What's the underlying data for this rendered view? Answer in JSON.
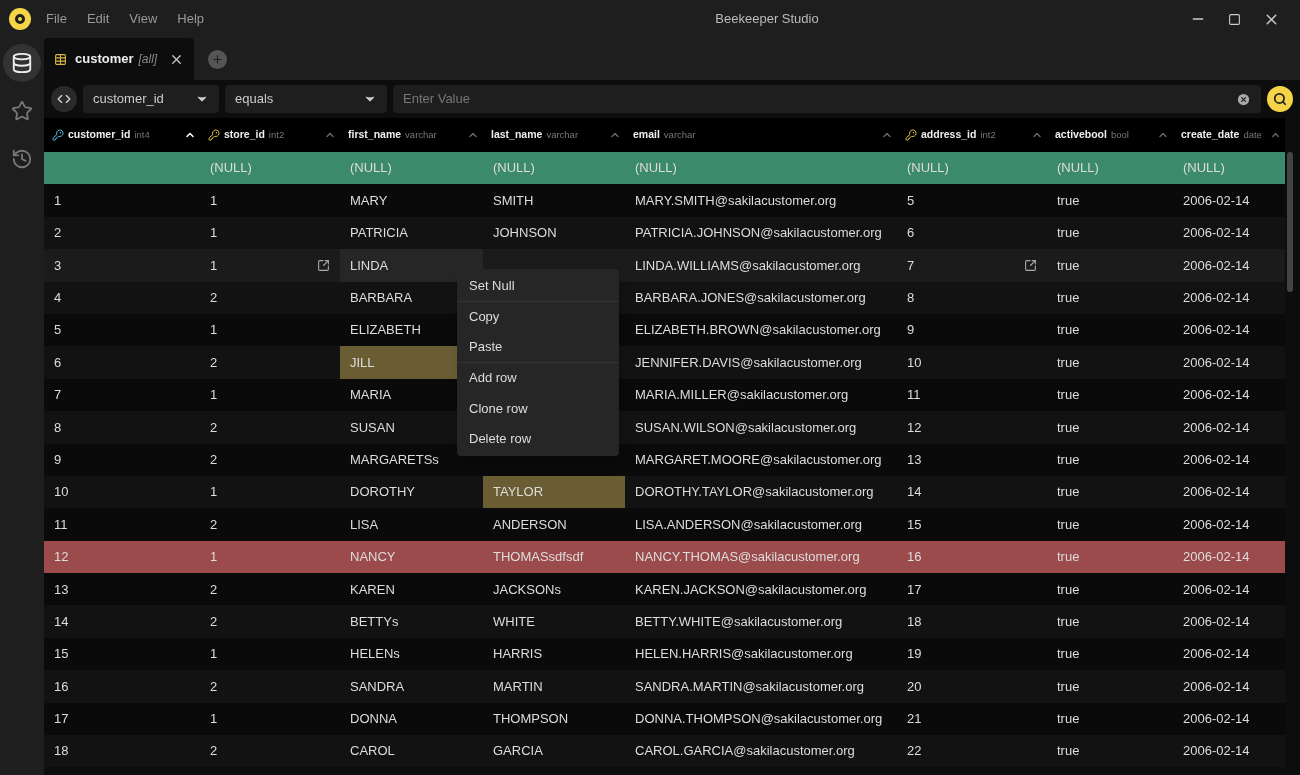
{
  "window": {
    "title": "Beekeeper Studio"
  },
  "menu_bar": [
    "File",
    "Edit",
    "View",
    "Help"
  ],
  "sidebar": [
    {
      "selected": true
    },
    {
      "selected": false
    },
    {
      "selected": false
    }
  ],
  "tabs": [
    {
      "label": "customer",
      "suffix": "[all]",
      "selected": true
    }
  ],
  "filter": {
    "column": "customer_id",
    "operator": "equals",
    "placeholder": "Enter Value"
  },
  "table": {
    "columns": [
      {
        "name": "customer_id",
        "type": "int4",
        "kind": "primary",
        "sorted": true
      },
      {
        "name": "store_id",
        "type": "int2",
        "kind": "foreign",
        "sorted": false
      },
      {
        "name": "first_name",
        "type": "varchar",
        "kind": "plain",
        "sorted": false
      },
      {
        "name": "last_name",
        "type": "varchar",
        "kind": "plain",
        "sorted": false
      },
      {
        "name": "email",
        "type": "varchar",
        "kind": "plain",
        "sorted": false
      },
      {
        "name": "address_id",
        "type": "int2",
        "kind": "foreign",
        "sorted": false
      },
      {
        "name": "activebool",
        "type": "bool",
        "kind": "plain",
        "sorted": false
      },
      {
        "name": "create_date",
        "type": "date",
        "kind": "plain",
        "sorted": false
      }
    ],
    "rows": [
      {
        "kind": "new",
        "hovered": false,
        "cells": [
          {
            "text": null,
            "edited": false
          },
          {
            "text": "(NULL)",
            "edited": false
          },
          {
            "text": "(NULL)",
            "edited": false
          },
          {
            "text": "(NULL)",
            "edited": false
          },
          {
            "text": "(NULL)",
            "edited": false
          },
          {
            "text": "(NULL)",
            "edited": false
          },
          {
            "text": "(NULL)",
            "edited": false
          },
          {
            "text": "(NULL)",
            "edited": false
          }
        ]
      },
      {
        "kind": "normal",
        "hovered": false,
        "cells": [
          {
            "text": "1",
            "edited": false
          },
          {
            "text": "1",
            "edited": false
          },
          {
            "text": "MARY",
            "edited": false
          },
          {
            "text": "SMITH",
            "edited": false
          },
          {
            "text": "MARY.SMITH@sakilacustomer.org",
            "edited": false
          },
          {
            "text": "5",
            "edited": false
          },
          {
            "text": "true",
            "edited": false
          },
          {
            "text": "2006-02-14",
            "edited": false
          }
        ]
      },
      {
        "kind": "normal",
        "hovered": false,
        "cells": [
          {
            "text": "2",
            "edited": false
          },
          {
            "text": "1",
            "edited": false
          },
          {
            "text": "PATRICIA",
            "edited": false
          },
          {
            "text": "JOHNSON",
            "edited": false
          },
          {
            "text": "PATRICIA.JOHNSON@sakilacustomer.org",
            "edited": false
          },
          {
            "text": "6",
            "edited": false
          },
          {
            "text": "true",
            "edited": false
          },
          {
            "text": "2006-02-14",
            "edited": false
          }
        ]
      },
      {
        "kind": "normal",
        "hovered": true,
        "cells": [
          {
            "text": "3",
            "edited": false
          },
          {
            "text": "1",
            "edited": false
          },
          {
            "text": "LINDA",
            "edited": false
          },
          {
            "text": null,
            "edited": false
          },
          {
            "text": "LINDA.WILLIAMS@sakilacustomer.org",
            "edited": false
          },
          {
            "text": "7",
            "edited": false
          },
          {
            "text": "true",
            "edited": false
          },
          {
            "text": "2006-02-14",
            "edited": false
          }
        ]
      },
      {
        "kind": "normal",
        "hovered": false,
        "cells": [
          {
            "text": "4",
            "edited": false
          },
          {
            "text": "2",
            "edited": false
          },
          {
            "text": "BARBARA",
            "edited": false
          },
          {
            "text": null,
            "edited": false
          },
          {
            "text": "BARBARA.JONES@sakilacustomer.org",
            "edited": false
          },
          {
            "text": "8",
            "edited": false
          },
          {
            "text": "true",
            "edited": false
          },
          {
            "text": "2006-02-14",
            "edited": false
          }
        ]
      },
      {
        "kind": "normal",
        "hovered": false,
        "cells": [
          {
            "text": "5",
            "edited": false
          },
          {
            "text": "1",
            "edited": false
          },
          {
            "text": "ELIZABETH",
            "edited": false
          },
          {
            "text": null,
            "edited": false
          },
          {
            "text": "ELIZABETH.BROWN@sakilacustomer.org",
            "edited": false
          },
          {
            "text": "9",
            "edited": false
          },
          {
            "text": "true",
            "edited": false
          },
          {
            "text": "2006-02-14",
            "edited": false
          }
        ]
      },
      {
        "kind": "normal",
        "hovered": false,
        "cells": [
          {
            "text": "6",
            "edited": false
          },
          {
            "text": "2",
            "edited": false
          },
          {
            "text": "JILL",
            "edited": true
          },
          {
            "text": null,
            "edited": false
          },
          {
            "text": "JENNIFER.DAVIS@sakilacustomer.org",
            "edited": false
          },
          {
            "text": "10",
            "edited": false
          },
          {
            "text": "true",
            "edited": false
          },
          {
            "text": "2006-02-14",
            "edited": false
          }
        ]
      },
      {
        "kind": "normal",
        "hovered": false,
        "cells": [
          {
            "text": "7",
            "edited": false
          },
          {
            "text": "1",
            "edited": false
          },
          {
            "text": "MARIA",
            "edited": false
          },
          {
            "text": null,
            "edited": false
          },
          {
            "text": "MARIA.MILLER@sakilacustomer.org",
            "edited": false
          },
          {
            "text": "11",
            "edited": false
          },
          {
            "text": "true",
            "edited": false
          },
          {
            "text": "2006-02-14",
            "edited": false
          }
        ]
      },
      {
        "kind": "normal",
        "hovered": false,
        "cells": [
          {
            "text": "8",
            "edited": false
          },
          {
            "text": "2",
            "edited": false
          },
          {
            "text": "SUSAN",
            "edited": false
          },
          {
            "text": null,
            "edited": false
          },
          {
            "text": "SUSAN.WILSON@sakilacustomer.org",
            "edited": false
          },
          {
            "text": "12",
            "edited": false
          },
          {
            "text": "true",
            "edited": false
          },
          {
            "text": "2006-02-14",
            "edited": false
          }
        ]
      },
      {
        "kind": "normal",
        "hovered": false,
        "cells": [
          {
            "text": "9",
            "edited": false
          },
          {
            "text": "2",
            "edited": false
          },
          {
            "text": "MARGARETSs",
            "edited": false
          },
          {
            "text": null,
            "edited": false
          },
          {
            "text": "MARGARET.MOORE@sakilacustomer.org",
            "edited": false
          },
          {
            "text": "13",
            "edited": false
          },
          {
            "text": "true",
            "edited": false
          },
          {
            "text": "2006-02-14",
            "edited": false
          }
        ]
      },
      {
        "kind": "normal",
        "hovered": false,
        "cells": [
          {
            "text": "10",
            "edited": false
          },
          {
            "text": "1",
            "edited": false
          },
          {
            "text": "DOROTHY",
            "edited": false
          },
          {
            "text": "TAYLOR",
            "edited": true
          },
          {
            "text": "DOROTHY.TAYLOR@sakilacustomer.org",
            "edited": false
          },
          {
            "text": "14",
            "edited": false
          },
          {
            "text": "true",
            "edited": false
          },
          {
            "text": "2006-02-14",
            "edited": false
          }
        ]
      },
      {
        "kind": "normal",
        "hovered": false,
        "cells": [
          {
            "text": "11",
            "edited": false
          },
          {
            "text": "2",
            "edited": false
          },
          {
            "text": "LISA",
            "edited": false
          },
          {
            "text": "ANDERSON",
            "edited": false
          },
          {
            "text": "LISA.ANDERSON@sakilacustomer.org",
            "edited": false
          },
          {
            "text": "15",
            "edited": false
          },
          {
            "text": "true",
            "edited": false
          },
          {
            "text": "2006-02-14",
            "edited": false
          }
        ]
      },
      {
        "kind": "deleted",
        "hovered": false,
        "cells": [
          {
            "text": "12",
            "edited": false
          },
          {
            "text": "1",
            "edited": false
          },
          {
            "text": "NANCY",
            "edited": false
          },
          {
            "text": "THOMASsdfsdf",
            "edited": false
          },
          {
            "text": "NANCY.THOMAS@sakilacustomer.org",
            "edited": false
          },
          {
            "text": "16",
            "edited": false
          },
          {
            "text": "true",
            "edited": false
          },
          {
            "text": "2006-02-14",
            "edited": false
          }
        ]
      },
      {
        "kind": "normal",
        "hovered": false,
        "cells": [
          {
            "text": "13",
            "edited": false
          },
          {
            "text": "2",
            "edited": false
          },
          {
            "text": "KAREN",
            "edited": false
          },
          {
            "text": "JACKSONs",
            "edited": false
          },
          {
            "text": "KAREN.JACKSON@sakilacustomer.org",
            "edited": false
          },
          {
            "text": "17",
            "edited": false
          },
          {
            "text": "true",
            "edited": false
          },
          {
            "text": "2006-02-14",
            "edited": false
          }
        ]
      },
      {
        "kind": "normal",
        "hovered": false,
        "cells": [
          {
            "text": "14",
            "edited": false
          },
          {
            "text": "2",
            "edited": false
          },
          {
            "text": "BETTYs",
            "edited": false
          },
          {
            "text": "WHITE",
            "edited": false
          },
          {
            "text": "BETTY.WHITE@sakilacustomer.org",
            "edited": false
          },
          {
            "text": "18",
            "edited": false
          },
          {
            "text": "true",
            "edited": false
          },
          {
            "text": "2006-02-14",
            "edited": false
          }
        ]
      },
      {
        "kind": "normal",
        "hovered": false,
        "cells": [
          {
            "text": "15",
            "edited": false
          },
          {
            "text": "1",
            "edited": false
          },
          {
            "text": "HELENs",
            "edited": false
          },
          {
            "text": "HARRIS",
            "edited": false
          },
          {
            "text": "HELEN.HARRIS@sakilacustomer.org",
            "edited": false
          },
          {
            "text": "19",
            "edited": false
          },
          {
            "text": "true",
            "edited": false
          },
          {
            "text": "2006-02-14",
            "edited": false
          }
        ]
      },
      {
        "kind": "normal",
        "hovered": false,
        "cells": [
          {
            "text": "16",
            "edited": false
          },
          {
            "text": "2",
            "edited": false
          },
          {
            "text": "SANDRA",
            "edited": false
          },
          {
            "text": "MARTIN",
            "edited": false
          },
          {
            "text": "SANDRA.MARTIN@sakilacustomer.org",
            "edited": false
          },
          {
            "text": "20",
            "edited": false
          },
          {
            "text": "true",
            "edited": false
          },
          {
            "text": "2006-02-14",
            "edited": false
          }
        ]
      },
      {
        "kind": "normal",
        "hovered": false,
        "cells": [
          {
            "text": "17",
            "edited": false
          },
          {
            "text": "1",
            "edited": false
          },
          {
            "text": "DONNA",
            "edited": false
          },
          {
            "text": "THOMPSON",
            "edited": false
          },
          {
            "text": "DONNA.THOMPSON@sakilacustomer.org",
            "edited": false
          },
          {
            "text": "21",
            "edited": false
          },
          {
            "text": "true",
            "edited": false
          },
          {
            "text": "2006-02-14",
            "edited": false
          }
        ]
      },
      {
        "kind": "normal",
        "hovered": false,
        "cells": [
          {
            "text": "18",
            "edited": false
          },
          {
            "text": "2",
            "edited": false
          },
          {
            "text": "CAROL",
            "edited": false
          },
          {
            "text": "GARCIA",
            "edited": false
          },
          {
            "text": "CAROL.GARCIA@sakilacustomer.org",
            "edited": false
          },
          {
            "text": "22",
            "edited": false
          },
          {
            "text": "true",
            "edited": false
          },
          {
            "text": "2006-02-14",
            "edited": false
          }
        ]
      }
    ]
  },
  "context_menu": [
    {
      "label": "Set Null",
      "divider_after": true
    },
    {
      "label": "Copy",
      "divider_after": false
    },
    {
      "label": "Paste",
      "divider_after": true
    },
    {
      "label": "Add row",
      "divider_after": false
    },
    {
      "label": "Clone row",
      "divider_after": false
    },
    {
      "label": "Delete row",
      "divider_after": false
    }
  ]
}
